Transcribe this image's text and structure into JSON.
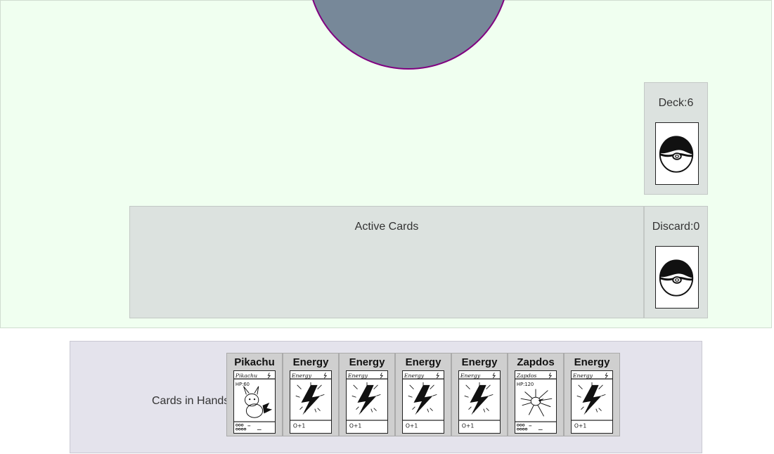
{
  "board": {
    "deck": {
      "label": "Deck:6",
      "icon": "pokeball-card-back-icon"
    },
    "discard": {
      "label": "Discard:0",
      "icon": "pokeball-card-back-icon"
    },
    "active": {
      "label": "Active Cards"
    }
  },
  "hand": {
    "label": "Cards in Hands",
    "cards": [
      {
        "name": "Pikachu",
        "art_title": "Pikachu",
        "hp": "HP:60",
        "kind": "pokemon",
        "icon": "pikachu-icon"
      },
      {
        "name": "Energy",
        "art_title": "Energy",
        "footer": "O+1",
        "kind": "energy",
        "icon": "lightning-icon"
      },
      {
        "name": "Energy",
        "art_title": "Energy",
        "footer": "O+1",
        "kind": "energy",
        "icon": "lightning-icon"
      },
      {
        "name": "Energy",
        "art_title": "Energy",
        "footer": "O+1",
        "kind": "energy",
        "icon": "lightning-icon"
      },
      {
        "name": "Energy",
        "art_title": "Energy",
        "footer": "O+1",
        "kind": "energy",
        "icon": "lightning-icon"
      },
      {
        "name": "Zapdos",
        "art_title": "Zapdos",
        "hp": "HP:120",
        "kind": "pokemon",
        "icon": "zapdos-icon"
      },
      {
        "name": "Energy",
        "art_title": "Energy",
        "footer": "O+1",
        "kind": "energy",
        "icon": "lightning-icon"
      }
    ]
  },
  "colors": {
    "board_bg": "#f0fff0",
    "opponent_fill": "#778899",
    "opponent_border": "#800080",
    "pile_bg": "#dce2df",
    "hand_bg": "#e4e3ec"
  }
}
